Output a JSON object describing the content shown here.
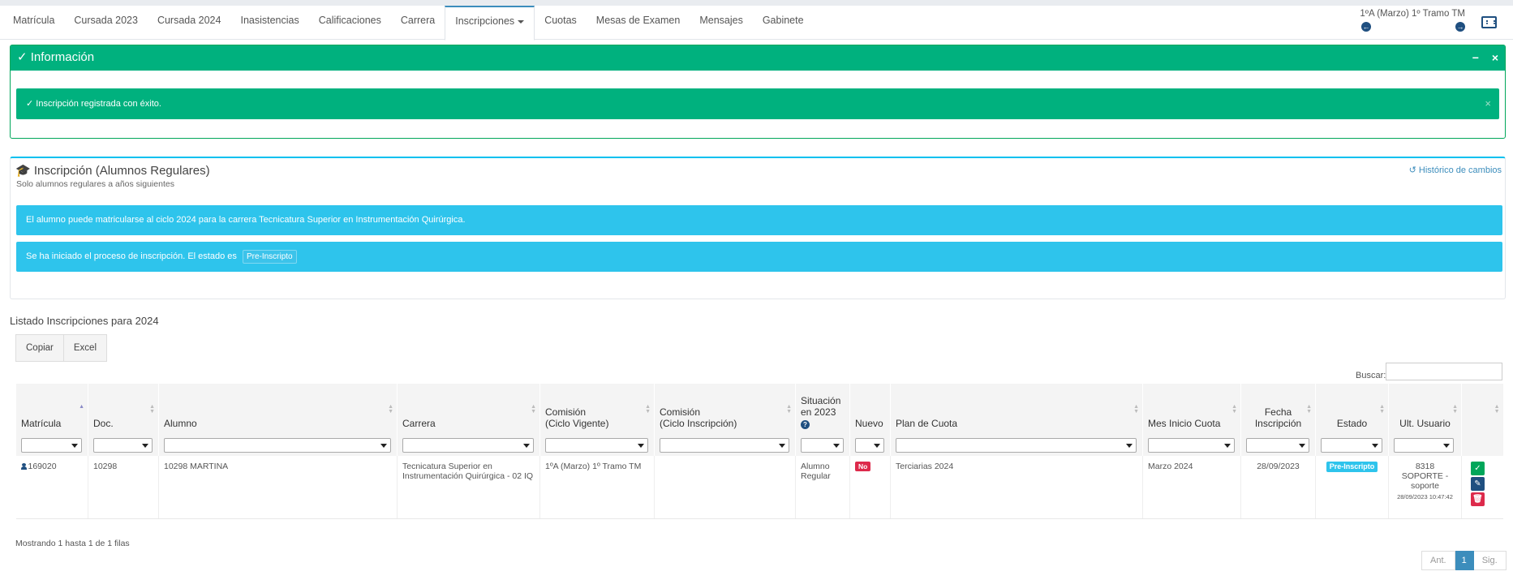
{
  "nav": {
    "tabs": [
      {
        "label": "Matrícula"
      },
      {
        "label": "Cursada 2023"
      },
      {
        "label": "Cursada 2024"
      },
      {
        "label": "Inasistencias"
      },
      {
        "label": "Calificaciones"
      },
      {
        "label": "Carrera"
      },
      {
        "label": "Inscripciones",
        "active": true,
        "dropdown": true
      },
      {
        "label": "Cuotas"
      },
      {
        "label": "Mesas de Examen"
      },
      {
        "label": "Mensajes"
      },
      {
        "label": "Gabinete"
      }
    ],
    "cycle_label": "1ºA (Marzo) 1º Tramo TM"
  },
  "info_box": {
    "title": "Información",
    "minimize": "−",
    "close": "×",
    "message": "Inscripción registrada con éxito.",
    "message_close": "×"
  },
  "inscription_box": {
    "title": "Inscripción (Alumnos Regulares)",
    "subtitle": "Solo alumnos regulares a años siguientes",
    "history_link": "Histórico de cambios",
    "alert1": "El alumno puede matricularse al ciclo 2024 para la carrera Tecnicatura Superior en Instrumentación Quirúrgica.",
    "alert2_text": "Se ha iniciado el proceso de inscripción. El estado es",
    "alert2_status": "Pre-Inscripto"
  },
  "listing": {
    "title": "Listado Inscripciones para 2024",
    "buttons": {
      "copy": "Copiar",
      "excel": "Excel"
    },
    "search_label": "Buscar:",
    "columns": {
      "matricula": "Matrícula",
      "doc": "Doc.",
      "alumno": "Alumno",
      "carrera": "Carrera",
      "comision_vig_1": "Comisión",
      "comision_vig_2": "(Ciclo Vigente)",
      "comision_insc_1": "Comisión",
      "comision_insc_2": "(Ciclo Inscripción)",
      "situacion_1": "Situación",
      "situacion_2": "en 2023",
      "nuevo": "Nuevo",
      "plan": "Plan de Cuota",
      "mes_inicio": "Mes Inicio Cuota",
      "fecha_1": "Fecha",
      "fecha_2": "Inscripción",
      "estado": "Estado",
      "ult_usuario": "Ult. Usuario"
    },
    "row": {
      "matricula": "169020",
      "doc": "10298",
      "alumno": "10298 MARTINA",
      "carrera": "Tecnicatura Superior en Instrumentación Quirúrgica - 02 IQ",
      "comision_vig": "1ºA (Marzo) 1º Tramo TM",
      "comision_insc": "",
      "situacion": "Alumno Regular",
      "nuevo": "No",
      "plan": "Terciarias 2024",
      "mes_inicio": "Marzo 2024",
      "fecha": "28/09/2023",
      "estado": "Pre-Inscripto",
      "usuario": "8318 SOPORTE - soporte",
      "usuario_fecha": "28/09/2023 10:47:42"
    },
    "showing": "Mostrando 1 hasta 1 de 1 filas",
    "pager": {
      "prev": "Ant.",
      "current": "1",
      "next": "Sig."
    }
  },
  "colors": {
    "success": "#00b17e",
    "info": "#2ec4ec",
    "primary": "#3c8dbc",
    "danger": "#dd2a4b",
    "dark_blue": "#1f4f80"
  }
}
